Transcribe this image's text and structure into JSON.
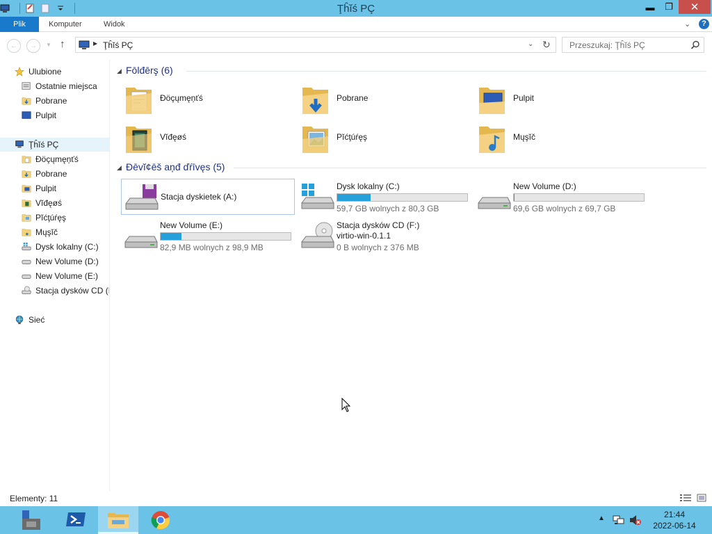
{
  "window": {
    "title": "Ţĥĭś PÇ",
    "buttons": {
      "minimize": "▬",
      "maximize": "❐",
      "close": "✕"
    }
  },
  "ribbon": {
    "tabs": [
      "Plik",
      "Komputer",
      "Widok"
    ],
    "help": "?"
  },
  "address": {
    "path": "Ţĥĭś PÇ",
    "search_placeholder": "Przeszukaj: Ţĥĭś PÇ"
  },
  "sidebar": {
    "favorites_header": "Ulubione",
    "favorites": [
      "Ostatnie miejsca",
      "Pobrane",
      "Pulpit"
    ],
    "pc_header": "Ţĥĭś PÇ",
    "pc_items": [
      "Đöçųmęņťś",
      "Pobrane",
      "Pulpit",
      "Vĭđęøś",
      "Pĭćţúŕęş",
      "Mųşĭč",
      "Dysk lokalny (C:)",
      "New Volume (D:)",
      "New Volume (E:)",
      "Stacja dysków CD (F"
    ],
    "network": "Sieć"
  },
  "groups": {
    "folders_title": "Fōlđērş (6)",
    "devices_title": "Đēvĭ¢ēš aņđ ďŕīvęs (5)"
  },
  "folders": [
    {
      "name": "Đöçųmęņťś",
      "icon": "documents-folder-icon"
    },
    {
      "name": "Pobrane",
      "icon": "downloads-folder-icon"
    },
    {
      "name": "Pulpit",
      "icon": "desktop-folder-icon"
    },
    {
      "name": "Vĭđęøś",
      "icon": "videos-folder-icon"
    },
    {
      "name": "Pĭćţúŕęş",
      "icon": "pictures-folder-icon"
    },
    {
      "name": "Mųşĭč",
      "icon": "music-folder-icon"
    }
  ],
  "drives": [
    {
      "name": "Stacja dyskietek (A:)",
      "icon": "floppy-drive-icon"
    },
    {
      "name": "Dysk lokalny (C:)",
      "info": "59,7 GB wolnych z 80,3 GB",
      "used_fraction": 0.257,
      "icon": "windows-drive-icon"
    },
    {
      "name": "New Volume (D:)",
      "info": "69,6 GB wolnych z 69,7 GB",
      "used_fraction": 0.002,
      "icon": "hard-drive-icon"
    },
    {
      "name": "New Volume (E:)",
      "info": "82,9 MB wolnych z 98,9 MB",
      "used_fraction": 0.162,
      "icon": "hard-drive-icon"
    },
    {
      "name": "Stacja dysków CD (F:)",
      "subtitle": "virtio-win-0.1.1",
      "info": "0 B wolnych z 376 MB",
      "icon": "cd-drive-icon"
    }
  ],
  "status": {
    "items": "Elementy: 11"
  },
  "taskbar": {
    "time": "21:44",
    "date": "2022-06-14"
  },
  "colors": {
    "accent": "#1979ca",
    "titlebar": "#6ac2e6",
    "drive_bar": "#26a0da",
    "group_title": "#1e3287"
  }
}
